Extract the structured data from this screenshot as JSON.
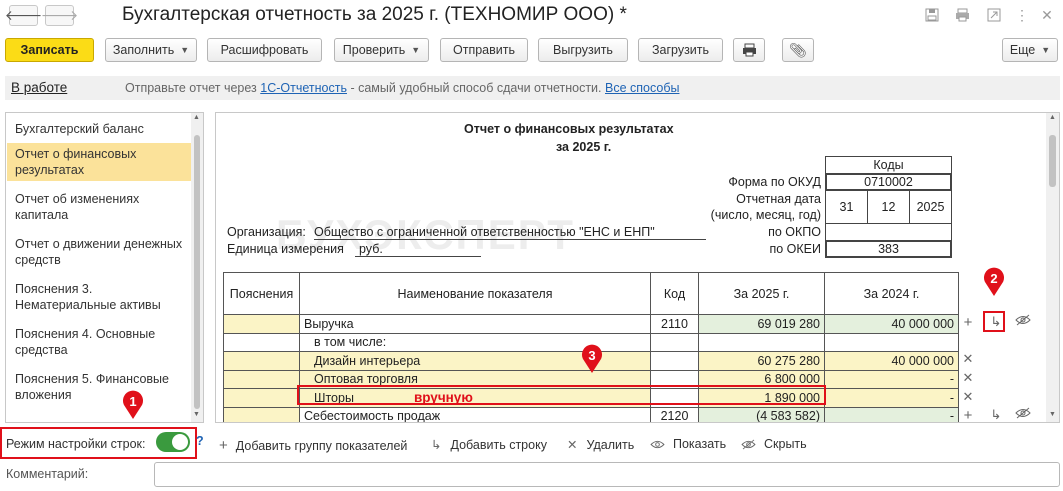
{
  "window": {
    "title": "Бухгалтерская отчетность за 2025 г. (ТЕХНОМИР ООО) *",
    "back_icon": "arrow-left",
    "forward_icon": "arrow-right"
  },
  "toolbar": {
    "save": "Записать",
    "fill": "Заполнить",
    "decode": "Расшифровать",
    "check": "Проверить",
    "send": "Отправить",
    "unload": "Выгрузить",
    "load": "Загрузить",
    "more": "Еще"
  },
  "info": {
    "status": "В работе",
    "text1": "Отправьте отчет через",
    "link1": "1С-Отчетность",
    "text2": " - самый удобный способ сдачи отчетности.",
    "link2": "Все способы"
  },
  "sidebar": {
    "items": [
      {
        "label": "Бухгалтерский баланс"
      },
      {
        "label": "Отчет о финансовых результатах"
      },
      {
        "label": "Отчет об изменениях капитала"
      },
      {
        "label": "Отчет о движении денежных средств"
      },
      {
        "label": "Пояснения 3. Нематериальные активы"
      },
      {
        "label": "Пояснения 4. Основные средства"
      },
      {
        "label": "Пояснения 5. Финансовые вложения"
      }
    ]
  },
  "report": {
    "title": "Отчет о финансовых результатах",
    "period": "за 2025 г.",
    "codes": "Коды",
    "okud_label": "Форма по ОКУД",
    "okud": "0710002",
    "date_label1": "Отчетная дата",
    "date_label2": "(число, месяц, год)",
    "day": "31",
    "month": "12",
    "year": "2025",
    "okpo_label": "по ОКПО",
    "okei_label": "по ОКЕИ",
    "okei": "383",
    "org_label": "Организация:",
    "org": "Общество с ограниченной ответственностью \"ЕНС и ЕНП\"",
    "unit_label": "Единица измерения",
    "unit": "руб.",
    "watermark": "БУХЭКСПЕРТ"
  },
  "table": {
    "headers": [
      "Пояснения",
      "Наименование показателя",
      "Код",
      "За 2025 г.",
      "За 2024 г."
    ],
    "rows": [
      {
        "name": "Выручка",
        "code": "2110",
        "cur": "69 019 280",
        "prev": "40 000 000"
      },
      {
        "name": "в том числе:",
        "code": "",
        "cur": "",
        "prev": ""
      },
      {
        "name": "Дизайн интерьера",
        "code": "",
        "cur": "60 275 280",
        "prev": "40 000 000"
      },
      {
        "name": "Оптовая торговля",
        "code": "",
        "cur": "6 800 000",
        "prev": "-"
      },
      {
        "name": "Шторы",
        "code": "",
        "cur": "1 890 000",
        "prev": "-"
      },
      {
        "name": "Себестоимость продаж",
        "code": "2120",
        "cur": "(4 583 582)",
        "prev": "-"
      }
    ],
    "manual_note": "вручную"
  },
  "annotations": {
    "m1": "1",
    "m2": "2",
    "m3": "3",
    "color": "#e0101a"
  },
  "bottom": {
    "mode_label": "Режим настройки строк:",
    "help": "?",
    "add_group": "Добавить группу показателей",
    "add_row": "Добавить строку",
    "delete": "Удалить",
    "show": "Показать",
    "hide": "Скрыть",
    "comment_label": "Комментарий:"
  }
}
